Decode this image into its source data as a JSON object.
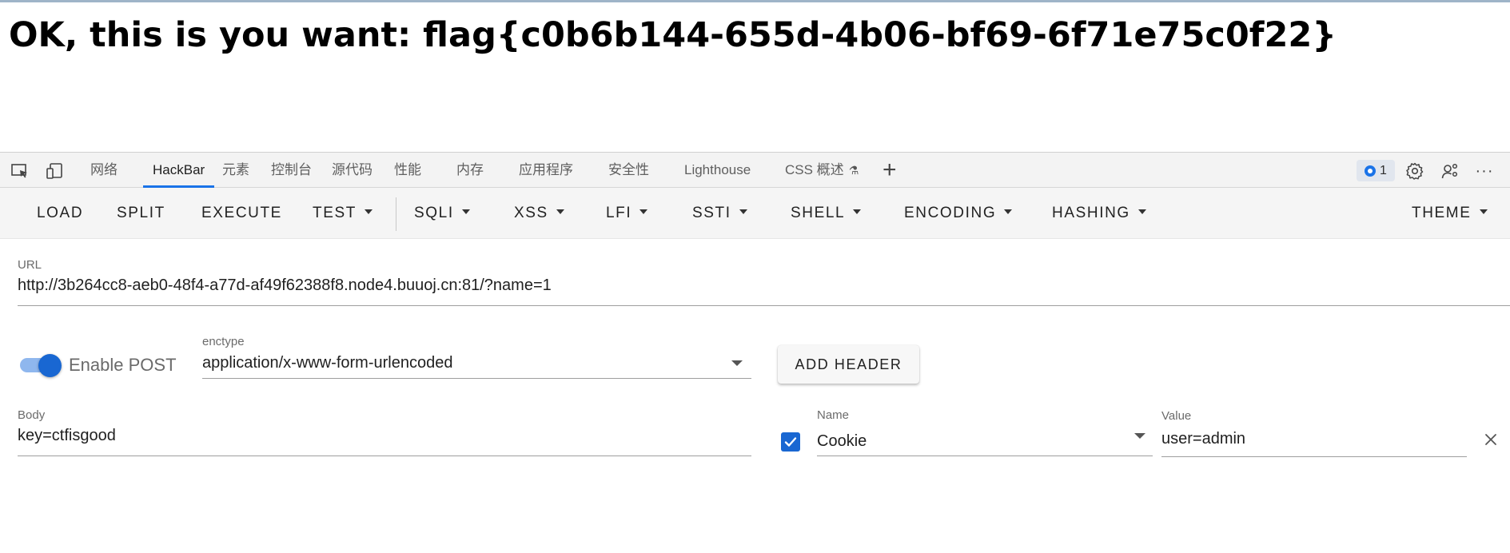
{
  "page": {
    "heading": "OK, this is you want: flag{c0b6b144-655d-4b06-bf69-6f71e75c0f22}"
  },
  "devtools": {
    "tabs": [
      "网络",
      "HackBar",
      "元素",
      "控制台",
      "源代码",
      "性能",
      "内存",
      "应用程序",
      "安全性",
      "Lighthouse",
      "CSS 概述"
    ],
    "active_tab": "HackBar",
    "issues_count": "1",
    "accent_color": "#1a73e8"
  },
  "hackbar": {
    "toolbar": {
      "load": "LOAD",
      "split": "SPLIT",
      "execute": "EXECUTE",
      "test": "TEST",
      "sqli": "SQLI",
      "xss": "XSS",
      "lfi": "LFI",
      "ssti": "SSTI",
      "shell": "SHELL",
      "encoding": "ENCODING",
      "hashing": "HASHING",
      "theme": "THEME"
    },
    "url": {
      "label": "URL",
      "value": "http://3b264cc8-aeb0-48f4-a77d-af49f62388f8.node4.buuoj.cn:81/?name=1"
    },
    "post": {
      "enabled": true,
      "toggle_label": "Enable POST",
      "enctype_label": "enctype",
      "enctype_value": "application/x-www-form-urlencoded",
      "body_label": "Body",
      "body_value": "key=ctfisgood"
    },
    "add_header_label": "ADD HEADER",
    "header": {
      "checked": true,
      "name_label": "Name",
      "name_value": "Cookie",
      "value_label": "Value",
      "value_value": "user=admin"
    }
  }
}
